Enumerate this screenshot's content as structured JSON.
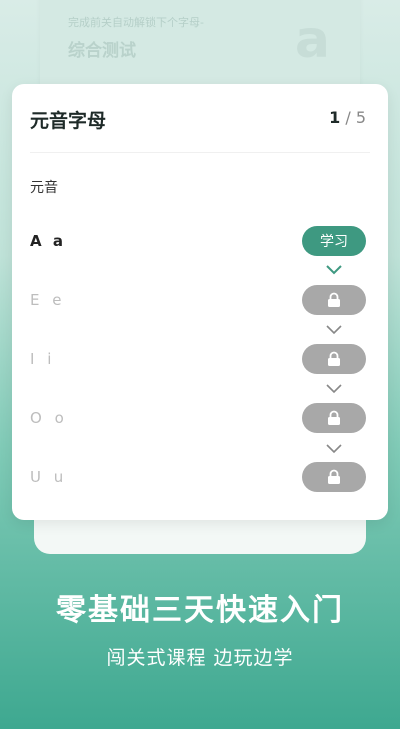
{
  "back_card": {
    "hint": "完成前关自动解锁下个字母-",
    "title": "综合测试",
    "letter": "a"
  },
  "card": {
    "title": "元音字母",
    "progress_current": "1",
    "progress_total": "/ 5",
    "section_label": "元音",
    "rows": [
      {
        "label": "A a",
        "status": "学习",
        "locked": false
      },
      {
        "label": "E e",
        "locked": true
      },
      {
        "label": "I i",
        "locked": true
      },
      {
        "label": "O o",
        "locked": true
      },
      {
        "label": "U u",
        "locked": true
      }
    ]
  },
  "promo": {
    "headline": "零基础三天快速入门",
    "subline": "闯关式课程 边玩边学"
  },
  "colors": {
    "accent": "#3e9981",
    "locked": "#a8a8a8",
    "chevron_active": "#3e9981",
    "chevron_inactive": "#888888"
  }
}
